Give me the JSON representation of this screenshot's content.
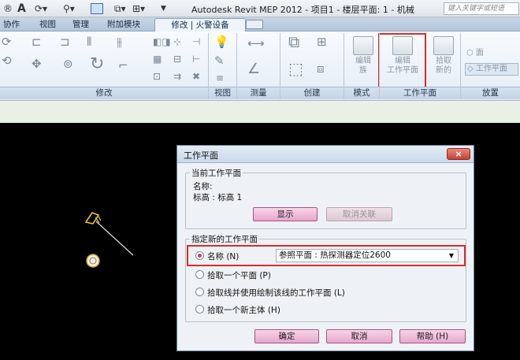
{
  "titlebar": {
    "app_title": "Autodesk Revit MEP 2012 -    项目1 - 楼层平面: 1 - 机械",
    "search_placeholder": "键入关键字或短语",
    "qa_icons": [
      "open-icon",
      "text-icon",
      "sync-icon",
      "measure-icon",
      "view-icon",
      "switch-icon"
    ]
  },
  "tabs": {
    "items": [
      "协作",
      "视图",
      "管理",
      "附加模块"
    ],
    "active": "修改 | 火警设备"
  },
  "ribbon": {
    "panels": {
      "modify": "修改",
      "view": "视图",
      "measure": "测量",
      "create": "创建",
      "mode": "模式",
      "workplane": "工作平面",
      "placement": "放置"
    },
    "buttons": {
      "edit_family": "编辑\n族",
      "edit_workplane": "编辑\n工作平面",
      "pick_new": "拾取\n新的",
      "face": "面",
      "workplane_small": "工作平面"
    }
  },
  "dialog": {
    "title": "工作平面",
    "close": "×",
    "current": {
      "group_title": "当前工作平面",
      "name_label": "名称:",
      "name_value": "标高 : 标高 1",
      "show_button": "显示",
      "dissociate_button": "取消关联"
    },
    "specify": {
      "group_title": "指定新的工作平面",
      "options": [
        {
          "label": "名称 (N)",
          "checked": true
        },
        {
          "label": "拾取一个平面 (P)",
          "checked": false
        },
        {
          "label": "拾取线并使用绘制该线的工作平面 (L)",
          "checked": false
        },
        {
          "label": "拾取一个新主体 (H)",
          "checked": false
        }
      ],
      "selected_plane": "参照平面 : 热探测器定位2600"
    },
    "footer": {
      "ok": "确定",
      "cancel": "取消",
      "help": "帮助 (H)"
    }
  },
  "colors": {
    "highlight": "#d92b2b",
    "button_pink": "#e7a7cb",
    "canvas": "#000000",
    "accent_radio": "#d23b6a"
  }
}
